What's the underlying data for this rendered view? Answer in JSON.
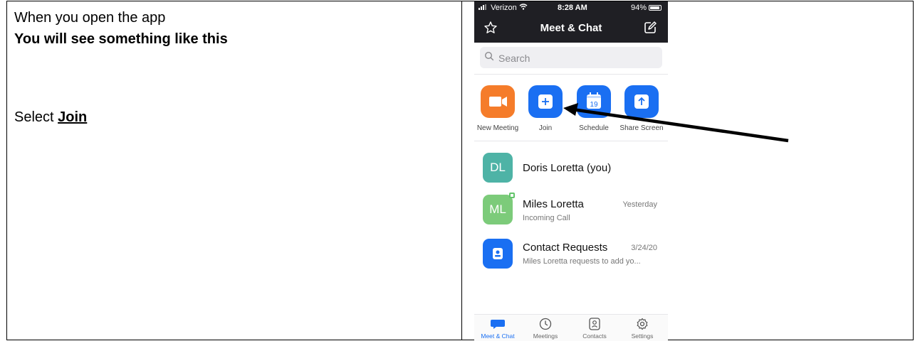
{
  "doc": {
    "line1": "When you open the app",
    "line2": "You will see something like this",
    "select_prefix": "Select ",
    "select_target": "Join"
  },
  "phone": {
    "status": {
      "carrier": "Verizon",
      "time": "8:28 AM",
      "battery": "94%"
    },
    "nav": {
      "title": "Meet & Chat",
      "left_icon": "star-icon",
      "right_icon": "compose-icon"
    },
    "search": {
      "placeholder": "Search"
    },
    "actions": [
      {
        "label": "New Meeting",
        "icon": "video-camera-icon",
        "color": "#f57c2a"
      },
      {
        "label": "Join",
        "icon": "plus-icon",
        "color": "#1a6ff2"
      },
      {
        "label": "Schedule",
        "icon": "calendar-icon",
        "color": "#1a6ff2",
        "day": "19"
      },
      {
        "label": "Share Screen",
        "icon": "share-screen-icon",
        "color": "#1a6ff2"
      }
    ],
    "contacts": [
      {
        "initials": "DL",
        "name": "Doris Loretta (you)",
        "sub": "",
        "date": ""
      },
      {
        "initials": "ML",
        "name": "Miles Loretta",
        "sub": "Incoming Call",
        "date": "Yesterday"
      },
      {
        "initials": "",
        "name": "Contact Requests",
        "sub": "Miles Loretta requests to add yo...",
        "date": "3/24/20"
      }
    ],
    "tabs": [
      {
        "label": "Meet & Chat",
        "icon": "chat-bubble-icon",
        "active": true
      },
      {
        "label": "Meetings",
        "icon": "clock-icon",
        "active": false
      },
      {
        "label": "Contacts",
        "icon": "contacts-icon",
        "active": false
      },
      {
        "label": "Settings",
        "icon": "gear-icon",
        "active": false
      }
    ]
  }
}
